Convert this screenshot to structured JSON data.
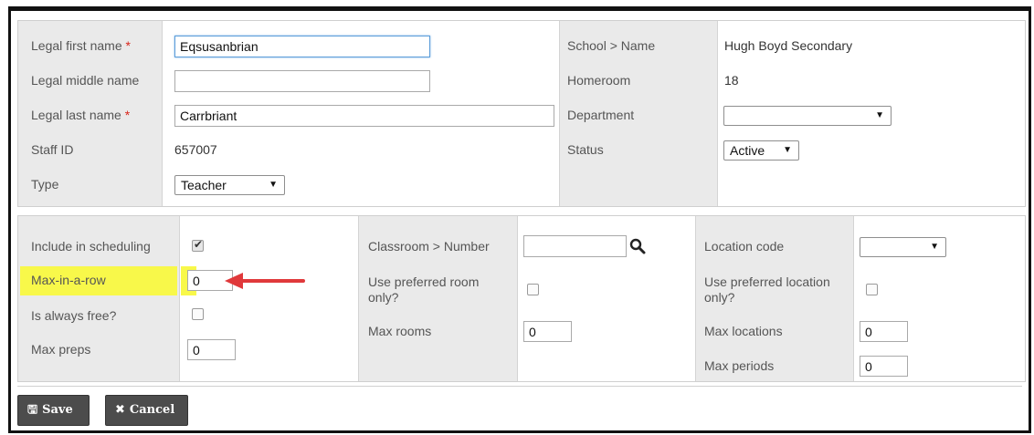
{
  "staff": {
    "first_name_label": "Legal first name",
    "first_name_value": "Eqsusanbrian",
    "middle_name_label": "Legal middle name",
    "middle_name_value": "",
    "last_name_label": "Legal last name",
    "last_name_value": "Carrbriant",
    "required_marker": "*",
    "staff_id_label": "Staff ID",
    "staff_id_value": "657007",
    "type_label": "Type",
    "type_value": "Teacher",
    "school_label": "School > Name",
    "school_value": "Hugh Boyd Secondary",
    "homeroom_label": "Homeroom",
    "homeroom_value": "18",
    "department_label": "Department",
    "department_value": "",
    "status_label": "Status",
    "status_value": "Active"
  },
  "scheduling": {
    "include_label": "Include in scheduling",
    "include_checked": true,
    "max_in_row_label": "Max-in-a-row",
    "max_in_row_value": "0",
    "always_free_label": "Is always free?",
    "always_free_checked": false,
    "max_preps_label": "Max preps",
    "max_preps_value": "0",
    "classroom_label": "Classroom > Number",
    "classroom_value": "",
    "pref_room_label_1": "Use preferred room",
    "pref_room_label_2": "only?",
    "pref_room_checked": false,
    "max_rooms_label": "Max rooms",
    "max_rooms_value": "0",
    "location_code_label": "Location code",
    "location_code_value": "",
    "pref_location_label_1": "Use preferred location",
    "pref_location_label_2": "only?",
    "pref_location_checked": false,
    "max_locations_label": "Max locations",
    "max_locations_value": "0",
    "max_periods_label": "Max periods",
    "max_periods_value": "0"
  },
  "buttons": {
    "save_label": "Save",
    "save_icon": "floppy-disk-icon",
    "cancel_label": "Cancel",
    "cancel_icon": "x-icon"
  },
  "colors": {
    "highlight": "#f8f84a",
    "arrow": "#e0393b",
    "required": "#d9261c",
    "button_bg": "#4c4c4c"
  }
}
